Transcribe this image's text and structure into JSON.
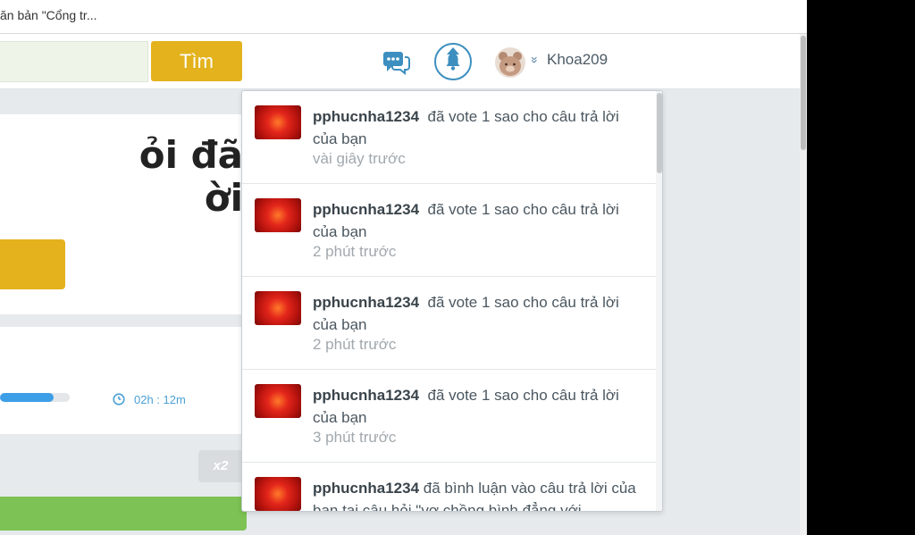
{
  "tab": {
    "title": "ăn bản \"Cổng tr..."
  },
  "header": {
    "search_button_label": "Tìm",
    "username": "Khoa209",
    "chevron_glyph": "»"
  },
  "page": {
    "question_heading": "ỏi đã\nời",
    "timer_text": "02h : 12m",
    "x2_label": "x2",
    "progress": 0.77
  },
  "notifications": [
    {
      "user": "pphucnha1234",
      "message": "đã vote 1 sao cho câu trả lời của bạn",
      "time": "vài giây trước"
    },
    {
      "user": "pphucnha1234",
      "message": "đã vote 1 sao cho câu trả lời của bạn",
      "time": "2 phút trước"
    },
    {
      "user": "pphucnha1234",
      "message": "đã vote 1 sao cho câu trả lời của bạn",
      "time": "2 phút trước"
    },
    {
      "user": "pphucnha1234",
      "message": "đã vote 1 sao cho câu trả lời của bạn",
      "time": "3 phút trước"
    },
    {
      "user": "pphucnha1234",
      "message": "đã bình luận vào câu trả lời của bạn tại câu hỏi \"vợ chồng bình đẳng với",
      "time": ""
    }
  ],
  "colors": {
    "accent_yellow": "#e3b21d",
    "accent_blue": "#3c8fbf",
    "accent_green": "#7cc254",
    "progress_blue": "#3d9ee8"
  },
  "icons": {
    "chat": "chat-bubbles-icon",
    "bell": "bell-icon",
    "clock": "clock-icon"
  }
}
